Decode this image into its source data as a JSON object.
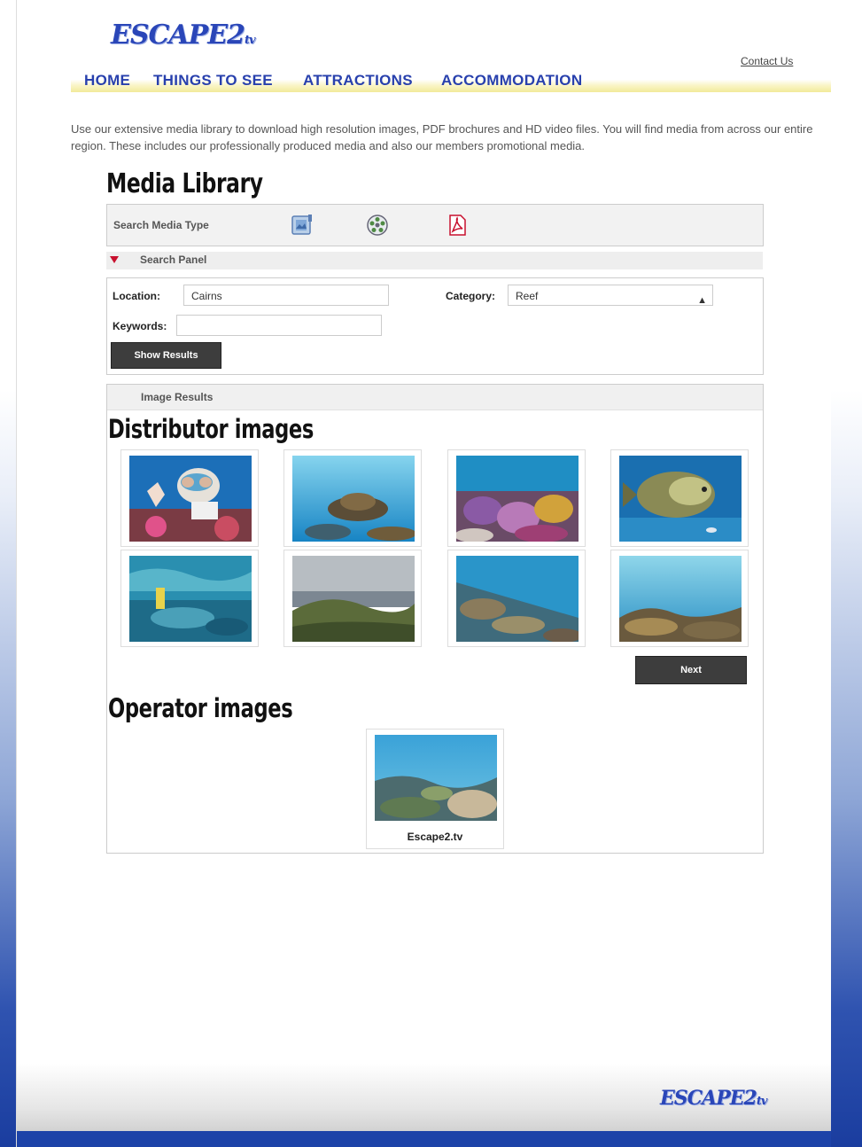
{
  "header": {
    "logo_text": "ESCAPE2",
    "logo_suffix": "tv",
    "contact_label": "Contact Us"
  },
  "nav": {
    "items": [
      "HOME",
      "THINGS TO SEE",
      "ATTRACTIONS",
      "ACCOMMODATION"
    ]
  },
  "intro": "Use our extensive media library to download high resolution images, PDF brochures and HD video files. You will find media from across our entire region. These includes our professionally produced media and also our members promotional media.",
  "media_library": {
    "title": "Media Library",
    "search_type_label": "Search Media Type",
    "type_icons": [
      "image-icon",
      "film-reel-icon",
      "pdf-icon"
    ]
  },
  "search_panel": {
    "header": "Search Panel",
    "location_label": "Location:",
    "location_value": "Cairns",
    "category_label": "Category:",
    "category_value": "Reef",
    "keywords_label": "Keywords:",
    "keywords_value": "",
    "show_results_label": "Show Results"
  },
  "results": {
    "header": "Image Results",
    "distributor_title": "Distributor images",
    "next_label": "Next",
    "operator_title": "Operator images",
    "operator_caption": "Escape2.tv"
  },
  "colors": {
    "nav_text": "#2840ad",
    "button_bg": "#3d3d3d",
    "accent_red": "#c8102e",
    "footer_blue": "#1d43a8"
  }
}
